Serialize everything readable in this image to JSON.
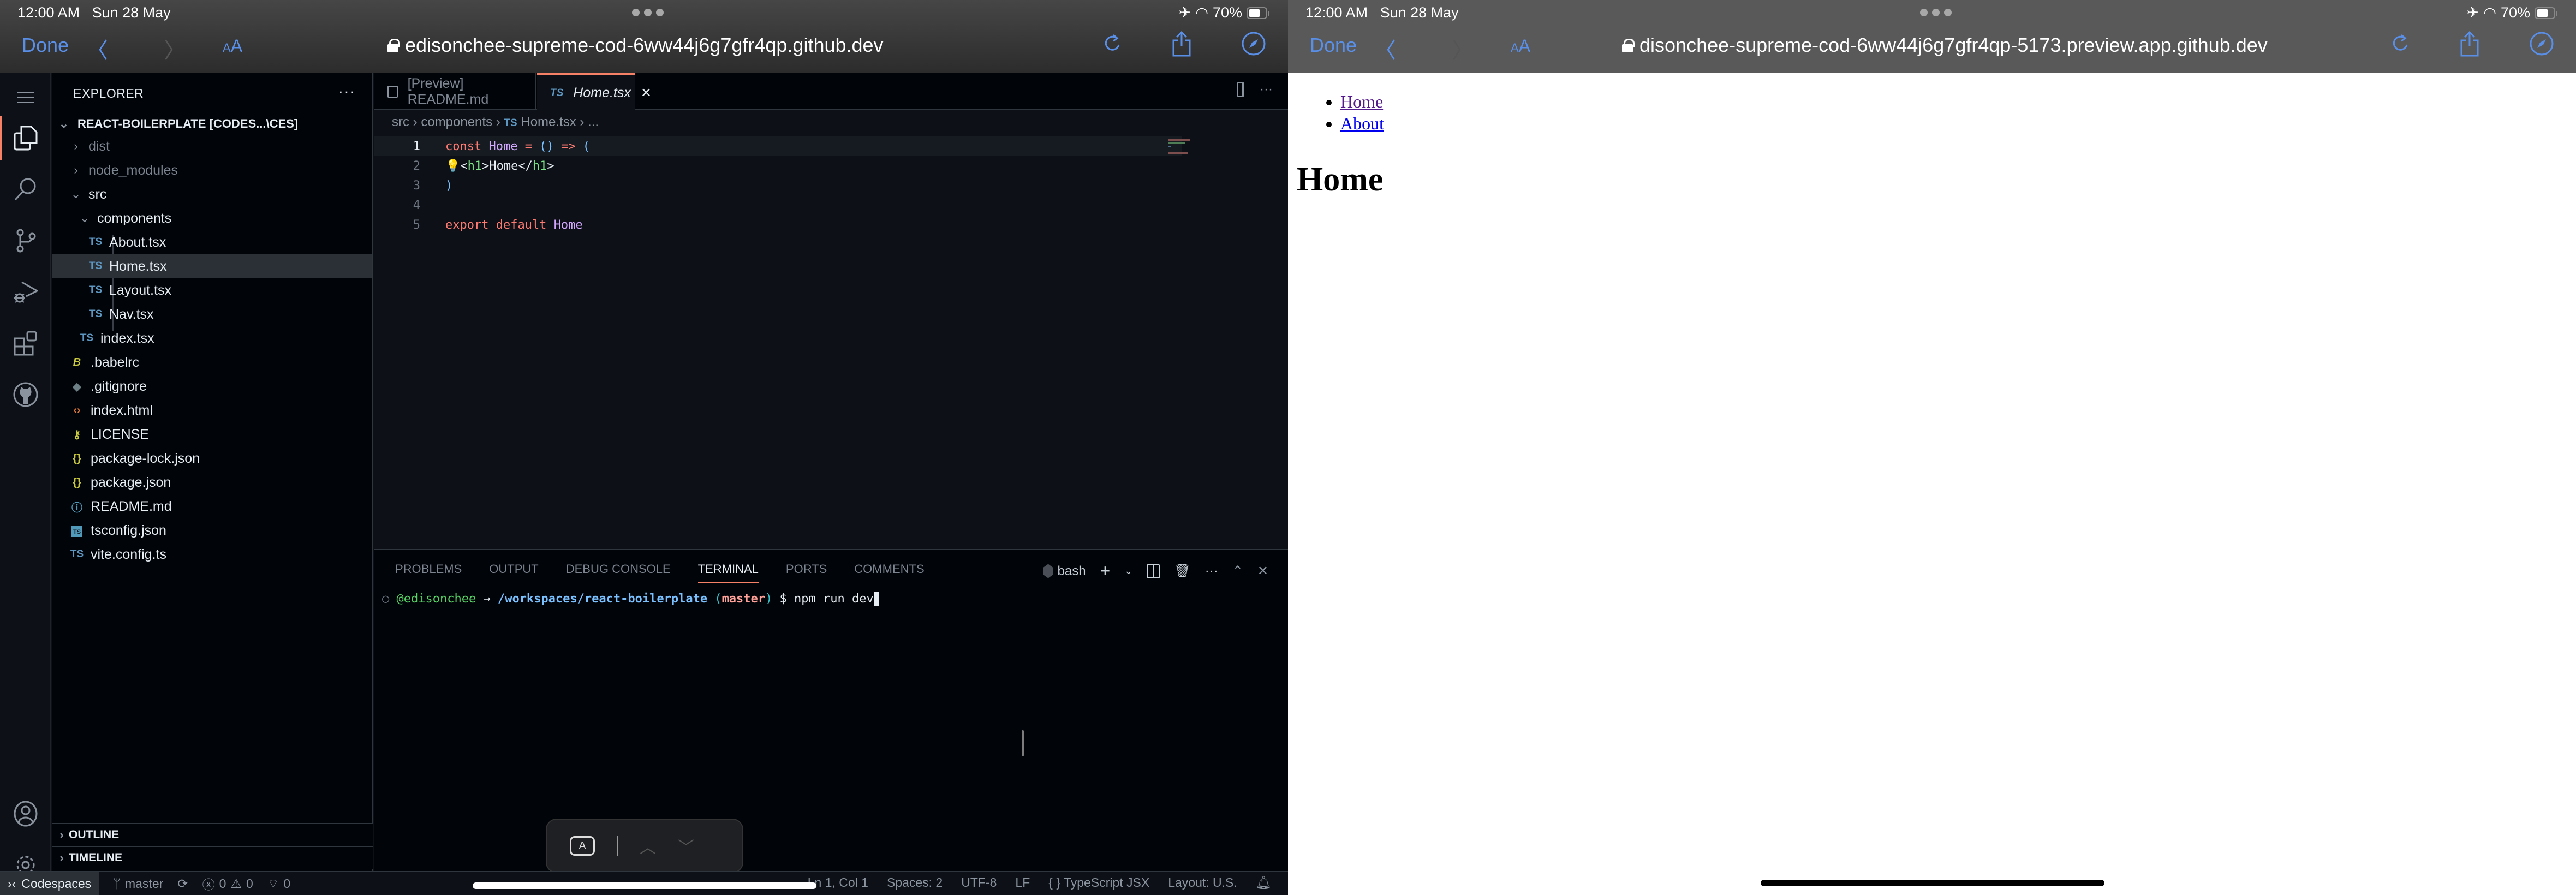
{
  "ios_status": {
    "time": "12:00 AM",
    "date": "Sun 28 May",
    "battery": "70%",
    "battery_fraction": 0.7
  },
  "left_browser": {
    "done_label": "Done",
    "text_size_label": "AA",
    "url": "edisonchee-supreme-cod-6ww44j6g7gfr4qp.github.dev"
  },
  "right_browser": {
    "done_label": "Done",
    "text_size_label": "AA",
    "url": "disonchee-supreme-cod-6ww44j6g7gfr4qp-5173.preview.app.github.dev"
  },
  "explorer": {
    "title": "EXPLORER",
    "root": "REACT-BOILERPLATE [CODES...\\CES]",
    "items": [
      {
        "name": "dist",
        "type": "folder",
        "collapsed": true
      },
      {
        "name": "node_modules",
        "type": "folder",
        "collapsed": true
      },
      {
        "name": "src",
        "type": "folder",
        "collapsed": false
      },
      {
        "name": "components",
        "type": "folder",
        "collapsed": false
      },
      {
        "name": "About.tsx",
        "icon": "TS"
      },
      {
        "name": "Home.tsx",
        "icon": "TS",
        "selected": true
      },
      {
        "name": "Layout.tsx",
        "icon": "TS"
      },
      {
        "name": "Nav.tsx",
        "icon": "TS"
      },
      {
        "name": "index.tsx",
        "icon": "TS"
      },
      {
        "name": ".babelrc",
        "icon": "babel-icon"
      },
      {
        "name": ".gitignore",
        "icon": "git-icon"
      },
      {
        "name": "index.html",
        "icon": "html-icon"
      },
      {
        "name": "LICENSE",
        "icon": "license-key-icon"
      },
      {
        "name": "package-lock.json",
        "icon": "json-icon"
      },
      {
        "name": "package.json",
        "icon": "json-icon"
      },
      {
        "name": "README.md",
        "icon": "info-icon"
      },
      {
        "name": "tsconfig.json",
        "icon": "tsconfig-icon"
      },
      {
        "name": "vite.config.ts",
        "icon": "TS"
      }
    ],
    "outline": "OUTLINE",
    "timeline": "TIMELINE"
  },
  "tabs": [
    {
      "label": "[Preview] README.md",
      "active": false
    },
    {
      "label": "Home.tsx",
      "prefix": "TS",
      "active": true
    }
  ],
  "breadcrumb": {
    "parts": [
      "src",
      "components",
      "Home.tsx",
      "..."
    ],
    "ts": "TS"
  },
  "code": {
    "line_numbers": [
      "1",
      "2",
      "3",
      "4",
      "5"
    ],
    "l1": {
      "k": "const",
      "fn": "Home",
      "eq": " = ",
      "p": "()",
      "arrow": " => ",
      "open": "("
    },
    "l2": {
      "lt": "<",
      "tag": "h1",
      "gt": ">",
      "txt": "Home",
      "lt2": "</",
      "tag2": "h1",
      "gt2": ">"
    },
    "l3": {
      "close": ")"
    },
    "l5": {
      "k": "export default",
      "fn": "Home"
    }
  },
  "panel": {
    "tabs": [
      "PROBLEMS",
      "OUTPUT",
      "DEBUG CONSOLE",
      "TERMINAL",
      "PORTS",
      "COMMENTS"
    ],
    "active_tab": "TERMINAL",
    "shell": "bash",
    "terminal": {
      "user": "@edisonchee",
      "arrow": " → ",
      "path": "/workspaces/react-boilerplate",
      "open": " (",
      "branch": "master",
      "close": ")",
      "prompt": " $ ",
      "command": "npm run dev"
    }
  },
  "statusbar": {
    "remote": "Codespaces",
    "branch": "master",
    "errors": "0",
    "warnings": "0",
    "ports": "0",
    "cursor": "Ln 1, Col 1",
    "spaces": "Spaces: 2",
    "encoding": "UTF-8",
    "eol": "LF",
    "language": "TypeScript JSX",
    "layout": "Layout: U.S."
  },
  "keyboard_bar": {
    "a_key": "A"
  },
  "preview": {
    "nav_links": [
      "Home",
      "About"
    ],
    "heading": "Home",
    "colors": {
      "visited": "#551a8b",
      "link": "#0000ee"
    }
  }
}
